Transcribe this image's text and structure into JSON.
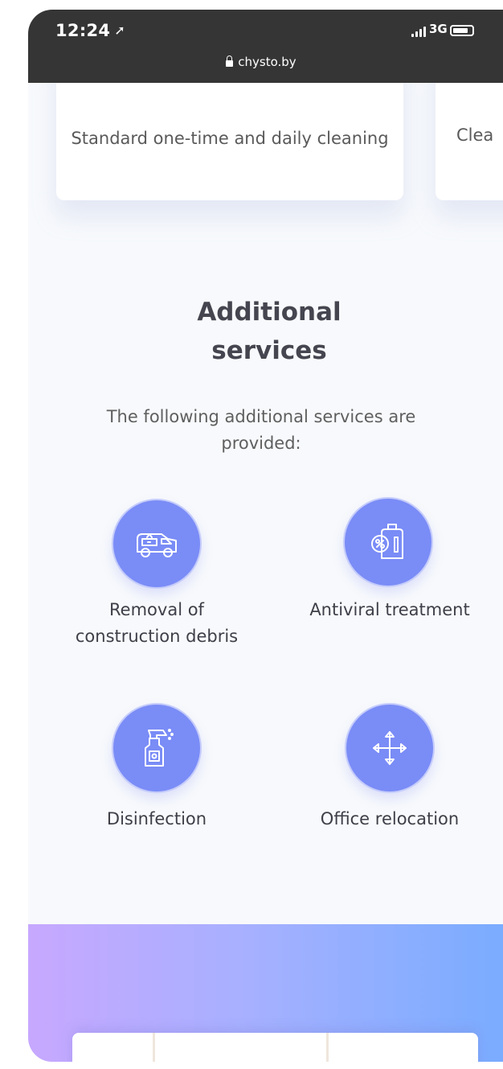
{
  "status_bar": {
    "time": "12:24",
    "location_icon": "location-arrow-icon",
    "network": "3G",
    "url": "chysto.by"
  },
  "cards": [
    {
      "text": "Standard one-time and daily cleaning"
    },
    {
      "text": "Clea"
    }
  ],
  "additional_services": {
    "title": "Additional services",
    "subtitle": "The following additional services are provided:",
    "items": [
      {
        "label": "Removal of construction debris",
        "icon": "truck-icon"
      },
      {
        "label": "Antiviral treatment",
        "icon": "antiviral-canister-icon"
      },
      {
        "label": "Disinfection",
        "icon": "spray-bottle-icon"
      },
      {
        "label": "Office relocation",
        "icon": "move-arrows-icon"
      }
    ]
  },
  "colors": {
    "status_bar": "#353535",
    "accent": "#7a8cf6",
    "gradient_start": "#c7a8ff",
    "gradient_end": "#79acff"
  }
}
